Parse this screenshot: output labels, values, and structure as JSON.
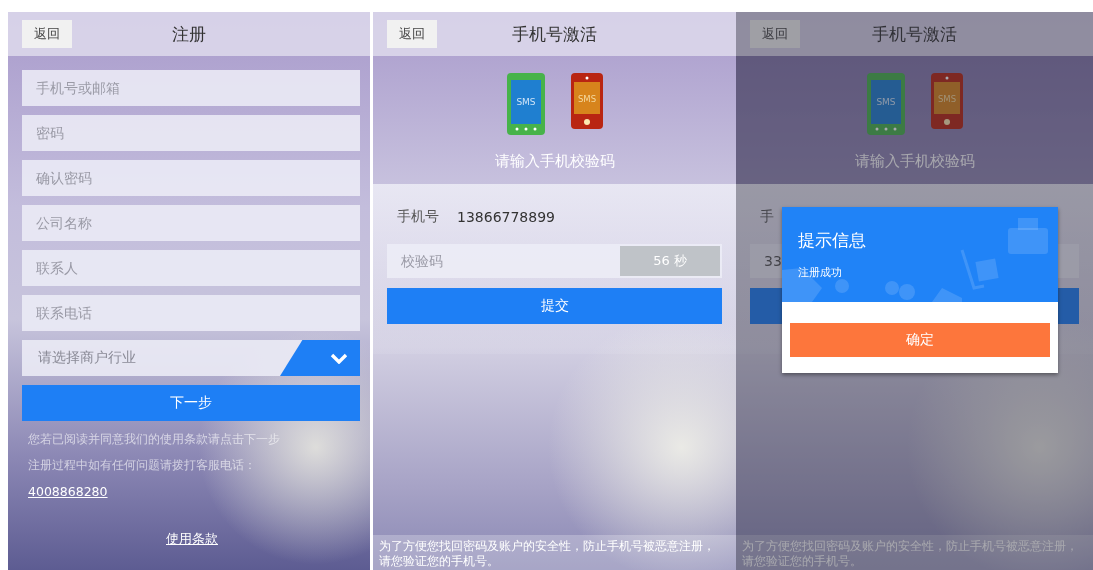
{
  "register_screen": {
    "back_button": "返回",
    "title": "注册",
    "fields": [
      {
        "placeholder": "手机号或邮箱"
      },
      {
        "placeholder": "密码"
      },
      {
        "placeholder": "确认密码"
      },
      {
        "placeholder": "公司名称"
      },
      {
        "placeholder": "联系人"
      },
      {
        "placeholder": "联系电话"
      }
    ],
    "industry_select": {
      "placeholder": "请选择商户行业"
    },
    "next_button": "下一步",
    "notes": [
      "您若已阅读并同意我们的使用条款请点击下一步",
      "注册过程中如有任何问题请拨打客服电话："
    ],
    "hotline": "4008868280",
    "terms_link": "使用条款"
  },
  "activation_screen": {
    "back_button": "返回",
    "title": "手机号激活",
    "phone_badges": [
      "SMS",
      "SMS"
    ],
    "prompt": "请输入手机校验码",
    "phone_label": "手机号",
    "phone_value": "13866778899",
    "code_field": {
      "placeholder": "校验码"
    },
    "countdown": "56 秒",
    "submit_button": "提交",
    "footer_note": "为了方便您找回密码及账户的安全性，防止手机号被恶意注册，请您验证您的手机号。"
  },
  "dialog_screen": {
    "back_button": "返回",
    "title": "手机号激活",
    "phone_badges": [
      "SMS",
      "SMS"
    ],
    "prompt": "请输入手机校验码",
    "phone_label": "手",
    "code_value": "33",
    "footer_note": "为了方便您找回密码及账户的安全性，防止手机号被恶意注册，请您验证您的手机号。",
    "dialog": {
      "title": "提示信息",
      "message": "注册成功",
      "confirm_button": "确定"
    }
  }
}
